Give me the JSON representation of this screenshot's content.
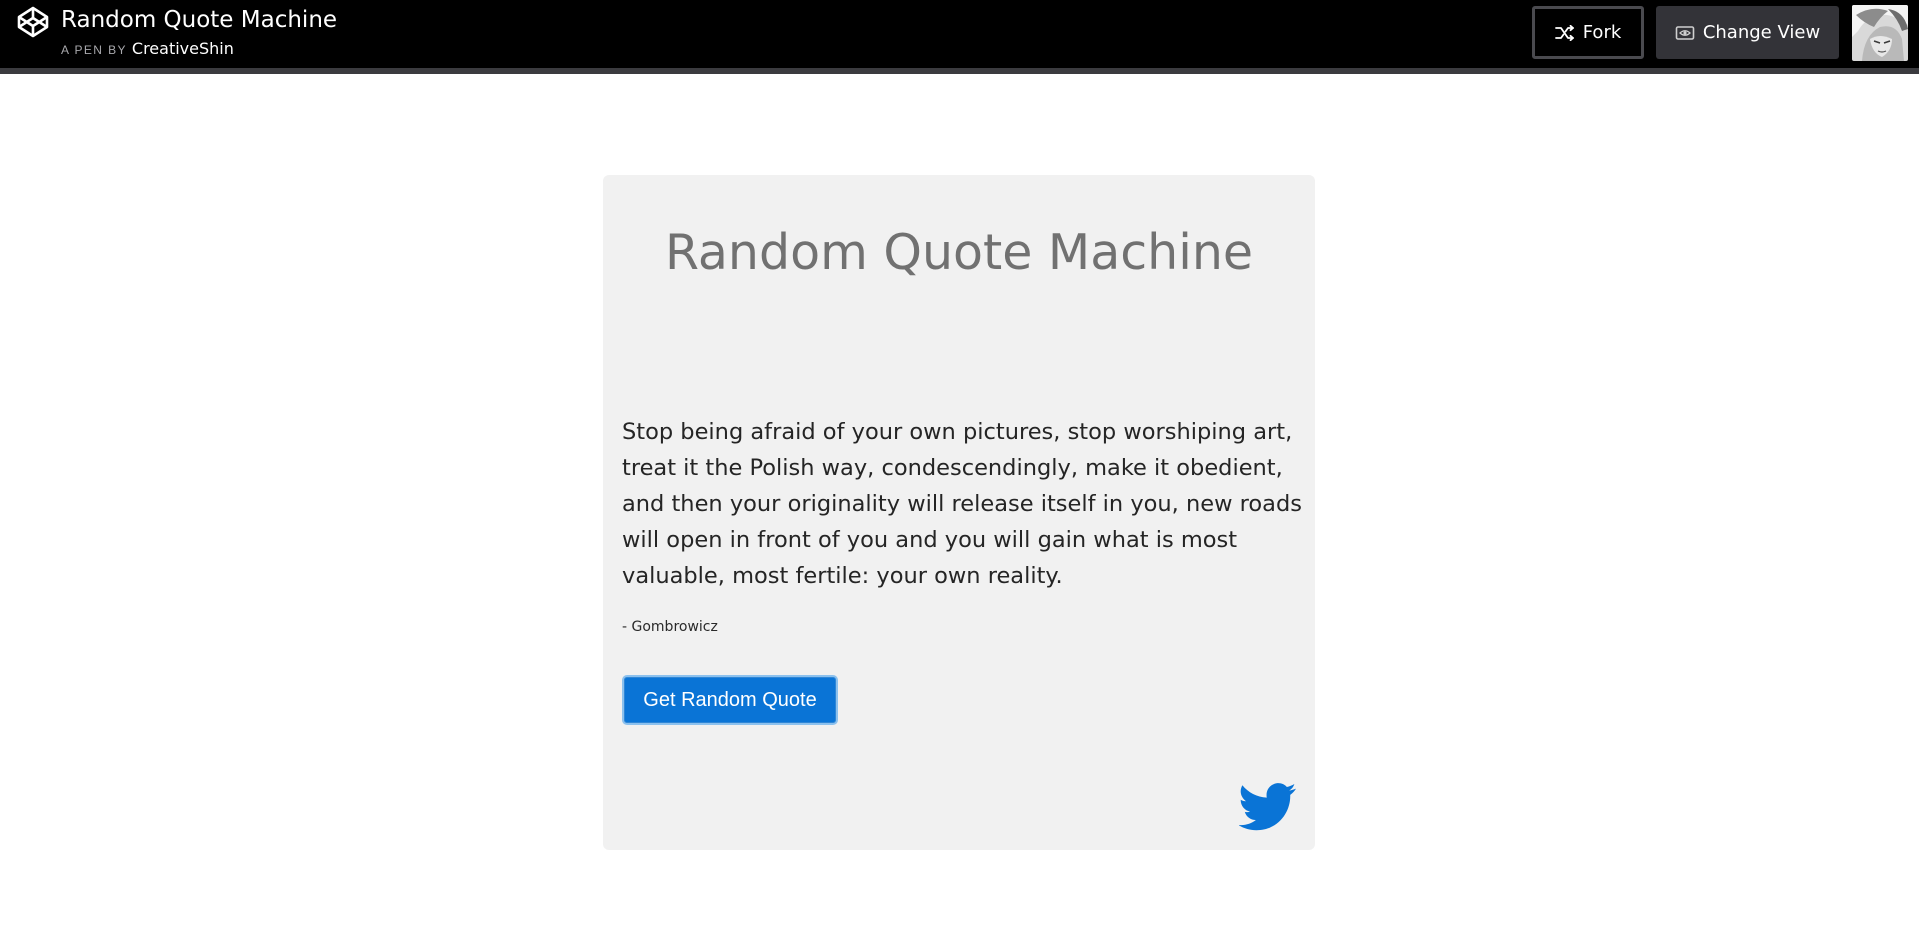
{
  "header": {
    "title": "Random Quote Machine",
    "byline_prefix": "A PEN BY",
    "author": "CreativeShin",
    "fork_label": "Fork",
    "change_view_label": "Change View"
  },
  "card": {
    "title": "Random Quote Machine",
    "quote": "Stop being afraid of your own pictures, stop worshiping art, treat it the Polish way, condescendingly, make it obedient, and then your originality will release itself in you, new roads will open in front of you and you will gain what is most valuable, most fertile: your own reality.",
    "author": "- Gombrowicz",
    "button_label": "Get Random Quote"
  },
  "icons": {
    "logo": "codepen-logo-icon",
    "fork": "fork-icon",
    "change_view": "change-view-icon",
    "twitter": "twitter-icon"
  },
  "colors": {
    "topbar_bg": "#000000",
    "card_bg": "#f1f1f1",
    "button_bg": "#0a74d6",
    "twitter_blue": "#0a74d6",
    "title_gray": "#717171"
  }
}
